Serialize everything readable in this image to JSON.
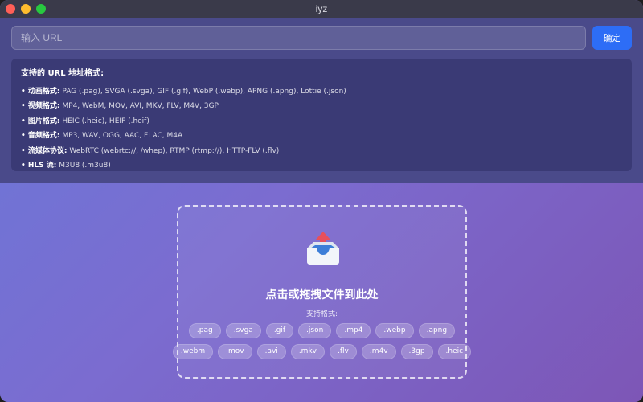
{
  "window": {
    "title": "iyz"
  },
  "url_bar": {
    "placeholder": "输入 URL",
    "value": "",
    "confirm_label": "确定"
  },
  "formats_panel": {
    "title": "支持的 URL 地址格式:",
    "lines": [
      {
        "label": "• 动画格式:",
        "text": "PAG (.pag), SVGA (.svga), GIF (.gif), WebP (.webp), APNG (.apng), Lottie (.json)"
      },
      {
        "label": "• 视频格式:",
        "text": "MP4, WebM, MOV, AVI, MKV, FLV, M4V, 3GP"
      },
      {
        "label": "• 图片格式:",
        "text": "HEIC (.heic), HEIF (.heif)"
      },
      {
        "label": "• 音频格式:",
        "text": "MP3, WAV, OGG, AAC, FLAC, M4A"
      },
      {
        "label": "• 流媒体协议:",
        "text": "WebRTC (webrtc://, /whep), RTMP (rtmp://), HTTP-FLV (.flv)"
      },
      {
        "label": "• HLS 流:",
        "text": "M3U8 (.m3u8)"
      }
    ]
  },
  "dropzone": {
    "icon": "inbox-tray-upload-icon",
    "title": "点击或拖拽文件到此处",
    "supported_label": "支持格式:",
    "chips_row1": [
      ".pag",
      ".svga",
      ".gif",
      ".json",
      ".mp4",
      ".webp",
      ".apng"
    ],
    "chips_row2": [
      ".webm",
      ".mov",
      ".avi",
      ".mkv",
      ".flv",
      ".m4v",
      ".3gp",
      ".heic"
    ]
  },
  "colors": {
    "accent": "#2d6df6",
    "panel": "#4a4a8a"
  }
}
